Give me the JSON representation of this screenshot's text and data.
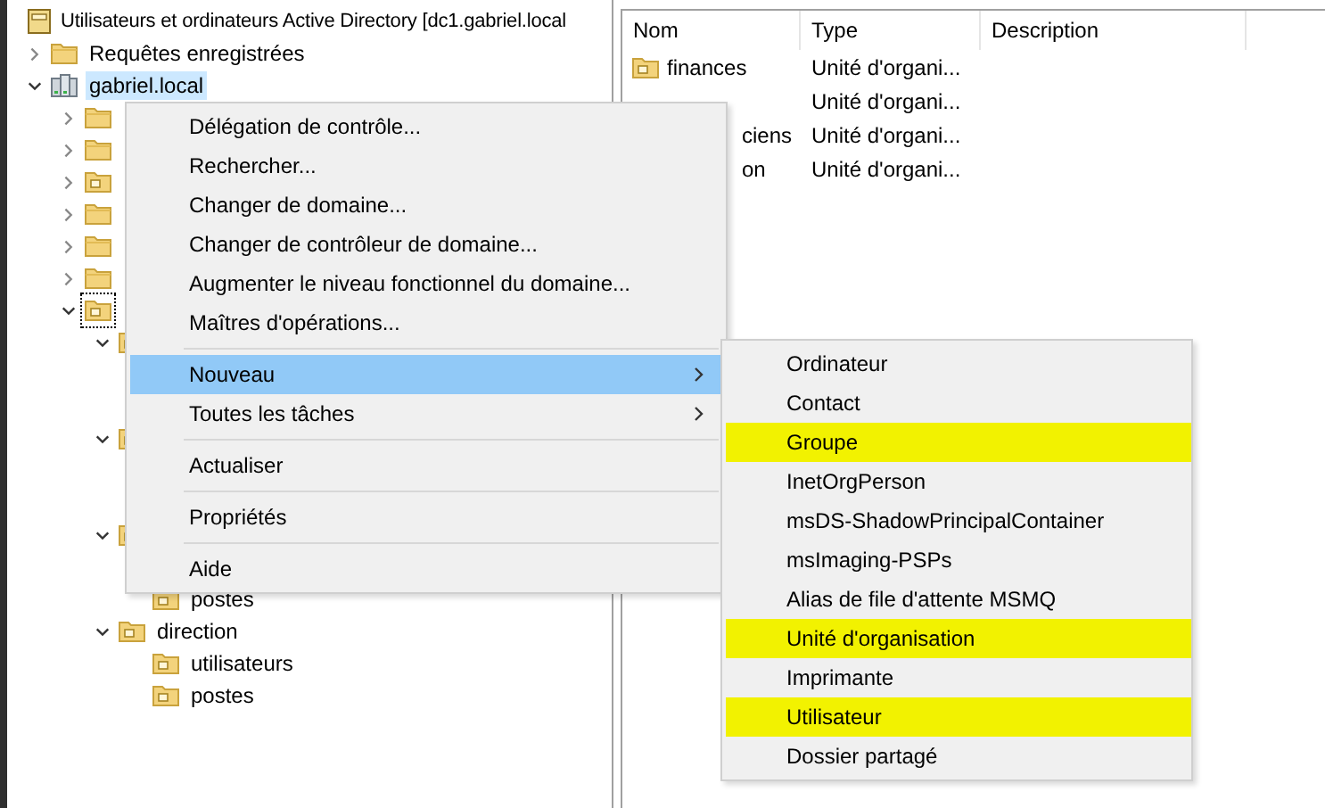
{
  "tree": {
    "label": "Utilisateurs et ordinateurs Active Directory [dc1.gabriel.local",
    "kind": "root",
    "children": [
      {
        "label": "Requêtes enregistrées",
        "kind": "folder",
        "expanded": false,
        "selected": false
      },
      {
        "label": "gabriel.local",
        "kind": "domain",
        "expanded": true,
        "selected": true,
        "children": [
          {
            "kind": "folder",
            "expanded": false
          },
          {
            "kind": "folder",
            "expanded": false
          },
          {
            "kind": "ou",
            "expanded": false
          },
          {
            "kind": "folder",
            "expanded": false
          },
          {
            "kind": "folder",
            "expanded": false
          },
          {
            "kind": "folder",
            "expanded": false
          },
          {
            "kind": "ou",
            "expanded": true,
            "focused": true,
            "children": [
              {
                "kind": "ou",
                "expanded": true
              },
              {
                "kind": "ou",
                "expanded": true
              },
              {
                "kind": "ou",
                "expanded": true,
                "children": [
                  {
                    "label": "postes",
                    "kind": "ou",
                    "selected": false
                  }
                ]
              },
              {
                "label": "direction",
                "kind": "ou",
                "expanded": true,
                "selected": false,
                "children": [
                  {
                    "label": "utilisateurs",
                    "kind": "ou",
                    "selected": false
                  },
                  {
                    "label": "postes",
                    "kind": "ou",
                    "selected": false
                  }
                ]
              }
            ]
          }
        ]
      }
    ]
  },
  "list": {
    "columns": [
      "Nom",
      "Type",
      "Description"
    ],
    "rows": [
      {
        "name": "finances",
        "kind": "ou",
        "type": "Unité d'organi..."
      },
      {
        "type": "Unité d'organi..."
      },
      {
        "name": "ciens",
        "kind": "ou",
        "type": "Unité d'organi...",
        "name_clipped": true
      },
      {
        "name": "on",
        "kind": "ou",
        "type": "Unité d'organi...",
        "name_clipped": true
      }
    ]
  },
  "context_menu": {
    "items": [
      {
        "kind": "item",
        "label": "Délégation de contrôle...",
        "selected": false
      },
      {
        "kind": "item",
        "label": "Rechercher...",
        "selected": false
      },
      {
        "kind": "item",
        "label": "Changer de domaine...",
        "selected": false
      },
      {
        "kind": "item",
        "label": "Changer de contrôleur de domaine...",
        "selected": false
      },
      {
        "kind": "item",
        "label": "Augmenter le niveau fonctionnel du domaine...",
        "selected": false
      },
      {
        "kind": "item",
        "label": "Maîtres d'opérations...",
        "selected": false
      },
      {
        "kind": "separator"
      },
      {
        "kind": "submenu",
        "label": "Nouveau",
        "selected": true
      },
      {
        "kind": "submenu",
        "label": "Toutes les tâches",
        "selected": false
      },
      {
        "kind": "separator"
      },
      {
        "kind": "item",
        "label": "Actualiser",
        "selected": false
      },
      {
        "kind": "separator"
      },
      {
        "kind": "item",
        "label": "Propriétés",
        "selected": false
      },
      {
        "kind": "separator"
      },
      {
        "kind": "item",
        "label": "Aide",
        "selected": false
      }
    ]
  },
  "submenu": {
    "items": [
      {
        "label": "Ordinateur",
        "highlighted": false
      },
      {
        "label": "Contact",
        "highlighted": false
      },
      {
        "label": "Groupe",
        "highlighted": true
      },
      {
        "label": "InetOrgPerson",
        "highlighted": false
      },
      {
        "label": "msDS-ShadowPrincipalContainer",
        "highlighted": false
      },
      {
        "label": "msImaging-PSPs",
        "highlighted": false
      },
      {
        "label": "Alias de file d'attente MSMQ",
        "highlighted": false
      },
      {
        "label": "Unité d'organisation",
        "highlighted": true
      },
      {
        "label": "Imprimante",
        "highlighted": false
      },
      {
        "label": "Utilisateur",
        "highlighted": true
      },
      {
        "label": "Dossier partagé",
        "highlighted": false
      }
    ]
  }
}
